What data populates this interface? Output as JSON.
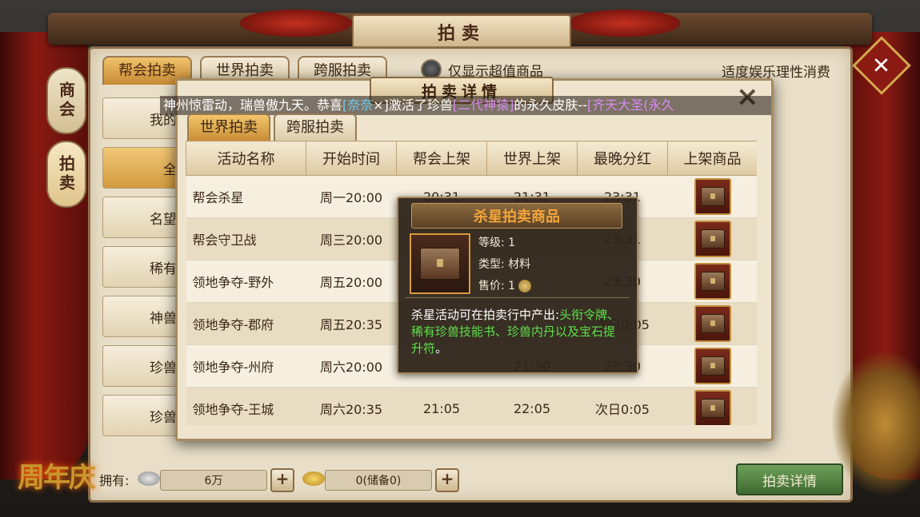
{
  "window": {
    "title": "拍卖"
  },
  "tabs": [
    "帮会拍卖",
    "世界拍卖",
    "跨服拍卖"
  ],
  "filter": {
    "label": "仅显示超值商品"
  },
  "notice": "适度娱乐理性消费",
  "side_tabs": [
    "商会",
    "拍卖"
  ],
  "left_list": {
    "items": [
      "我的",
      "全",
      "名望",
      "稀有",
      "神兽",
      "珍兽",
      "珍兽"
    ]
  },
  "bottom": {
    "own_label": "拥有:",
    "silver": "6万",
    "gold": "0(储备0)",
    "detail_button": "拍卖详情"
  },
  "logo": "周年庆",
  "broadcast": {
    "prefix": "神州惊雷动，瑞兽傲九天。恭喜",
    "player": "[奈奈",
    "mid1": "×]激活了珍兽",
    "pet": "[二代神猿]",
    "mid2": "的永久皮肤--",
    "skin": "[齐天大圣(永久"
  },
  "modal": {
    "title": "拍卖详情",
    "close": "×",
    "tabs": [
      "世界拍卖",
      "跨服拍卖"
    ],
    "columns": [
      "活动名称",
      "开始时间",
      "帮会上架",
      "世界上架",
      "最晚分红",
      "上架商品"
    ],
    "rows": [
      {
        "name": "帮会杀星",
        "start": "周一20:00",
        "guild": "20:31",
        "world": "21:31",
        "bonus": "23:31"
      },
      {
        "name": "帮会守卫战",
        "start": "周三20:00",
        "guild": "",
        "world": "",
        "bonus": "23:31"
      },
      {
        "name": "领地争夺-野外",
        "start": "周五20:00",
        "guild": "",
        "world": "",
        "bonus": "23:30"
      },
      {
        "name": "领地争夺-郡府",
        "start": "周五20:35",
        "guild": "",
        "world": "",
        "bonus": "次日0:05"
      },
      {
        "name": "领地争夺-州府",
        "start": "周六20:00",
        "guild": "",
        "world": "21:30",
        "bonus": "23:30"
      },
      {
        "name": "领地争夺-王城",
        "start": "周六20:35",
        "guild": "21:05",
        "world": "22:05",
        "bonus": "次日0:05"
      }
    ]
  },
  "tooltip": {
    "title": "杀星拍卖商品",
    "level": "等级: 1",
    "type": "类型: 材料",
    "price": "售价: 1",
    "desc_prefix": "杀星活动可在拍卖行中产出:",
    "desc_items": "头衔令牌、稀有珍兽技能书、珍兽内丹以及宝石提升符",
    "desc_suffix": "。"
  },
  "icons": {
    "close": "close-icon",
    "chest": "treasure-chest-icon",
    "coin": "coin-icon",
    "silver": "silver-ingot-icon",
    "gold": "gold-ingot-icon"
  }
}
